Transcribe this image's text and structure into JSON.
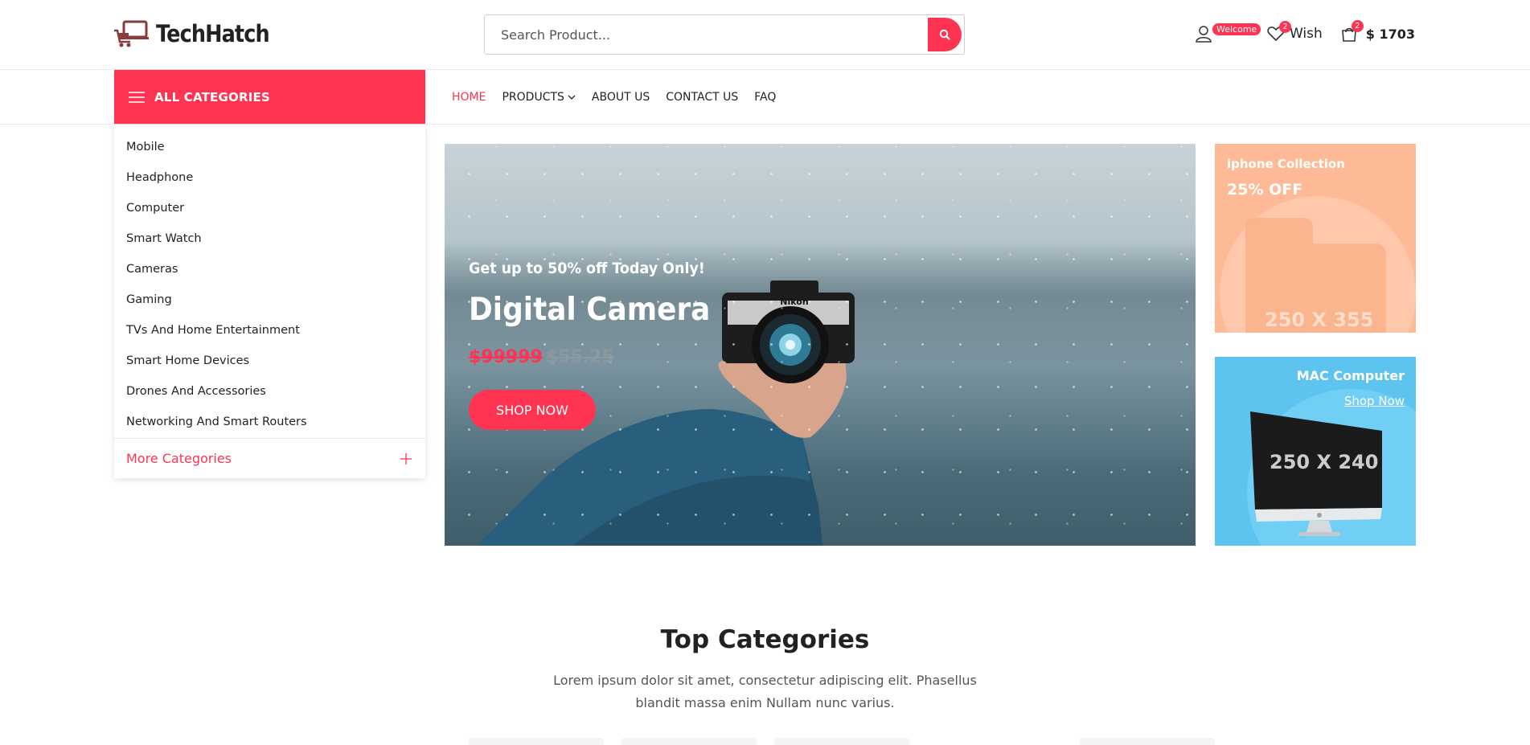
{
  "brand": {
    "name": "TechHatch",
    "accent": "#ff3352"
  },
  "search": {
    "placeholder": "Search Product...",
    "button_icon": "search-icon"
  },
  "header": {
    "account_badge": "Welcome",
    "wish_count": "2",
    "wish_label": "Wish",
    "cart_count": "2",
    "cart_total": "$ 1703"
  },
  "nav": {
    "all_categories": "ALL CATEGORIES",
    "links": [
      "HOME",
      "PRODUCTS",
      "ABOUT US",
      "CONTACT US",
      "FAQ"
    ]
  },
  "categories": {
    "items": [
      "Mobile",
      "Headphone",
      "Computer",
      "Smart Watch",
      "Cameras",
      "Gaming",
      "TVs And Home Entertainment",
      "Smart Home Devices",
      "Drones And Accessories",
      "Networking And Smart Routers"
    ],
    "more": "More Categories"
  },
  "hero": {
    "subtitle": "Get up to 50% off Today Only!",
    "title": "Digital Camera",
    "price_new": "$99999",
    "price_old": "$55.25",
    "button": "SHOP NOW"
  },
  "banners": {
    "iphone": {
      "title": "iphone Collection",
      "discount": "25% OFF",
      "placeholder": "250 X 355"
    },
    "mac": {
      "title": "MAC Computer",
      "link": "Shop Now",
      "placeholder": "250 X 240"
    }
  },
  "top_categories": {
    "title": "Top Categories",
    "description": "Lorem ipsum dolor sit amet, consectetur adipiscing elit. Phasellus blandit massa enim Nullam nunc varius."
  }
}
